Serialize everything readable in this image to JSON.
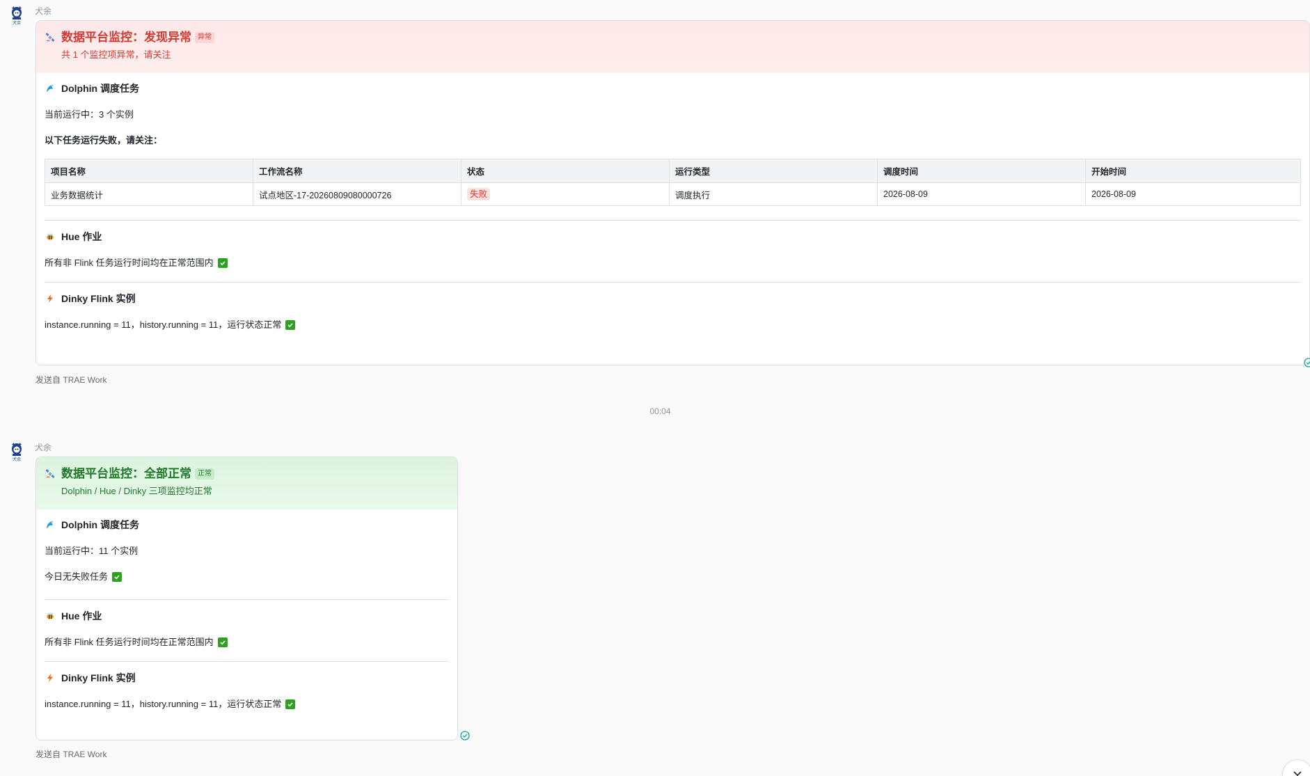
{
  "messages": [
    {
      "sender": "犬余",
      "header": {
        "title": "数据平台监控：发现异常",
        "tag": "异常",
        "subtitle": "共 1 个监控项异常，请关注"
      },
      "dolphin": {
        "title": "Dolphin 调度任务",
        "running": "当前运行中：3 个实例",
        "failed_heading": "以下任务运行失败，请关注：",
        "table": {
          "headers": [
            "项目名称",
            "工作流名称",
            "状态",
            "运行类型",
            "调度时间",
            "开始时间"
          ],
          "rows": [
            [
              "业务数据统计",
              "试点地区-17-20260809080000726",
              "失败",
              "调度执行",
              "2026-08-09",
              "2026-08-09"
            ]
          ]
        }
      },
      "hue": {
        "title": "Hue 作业",
        "status": "所有非 Flink 任务运行时间均在正常范围内"
      },
      "dinky": {
        "title": "Dinky Flink 实例",
        "status": "instance.running = 11，history.running = 11，运行状态正常"
      },
      "footer": "发送自 TRAE Work"
    },
    {
      "sender": "犬余",
      "header": {
        "title": "数据平台监控：全部正常",
        "tag": "正常",
        "subtitle": "Dolphin / Hue / Dinky 三项监控均正常"
      },
      "dolphin": {
        "title": "Dolphin 调度任务",
        "running": "当前运行中：11 个实例",
        "no_fail": "今日无失败任务"
      },
      "hue": {
        "title": "Hue 作业",
        "status": "所有非 Flink 任务运行时间均在正常范围内"
      },
      "dinky": {
        "title": "Dinky Flink 实例",
        "status": "instance.running = 11，history.running = 11，运行状态正常"
      },
      "footer": "发送自 TRAE Work"
    }
  ],
  "time_separator": "00:04",
  "colors": {
    "alert_red": "#d83931",
    "ok_green": "#1f7a2b",
    "check_green": "#2ea121",
    "read_teal": "#14a3a0"
  },
  "icons": {
    "avatar": "cartoon-avatar-icon",
    "header": "satellite-icon",
    "dolphin": "dolphin-icon",
    "hue": "bee-icon",
    "dinky": "lightning-icon",
    "check": "check-box-icon",
    "read": "read-receipt-icon",
    "scroll": "chevron-down-icon"
  }
}
